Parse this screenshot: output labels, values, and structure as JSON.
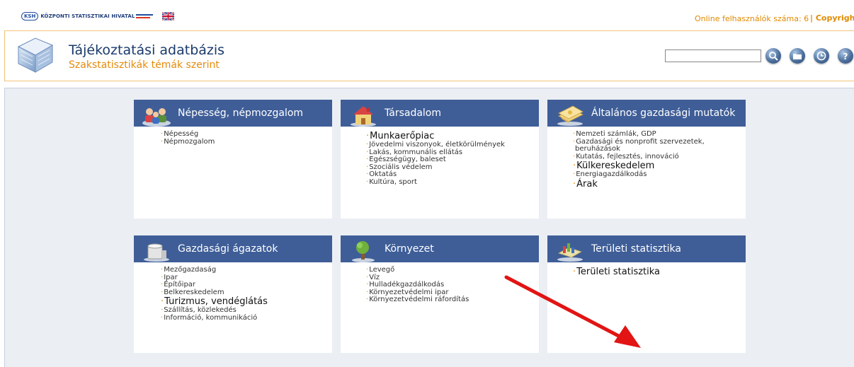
{
  "topbar": {
    "logo_abbr": "KSH",
    "logo_text": "KÖZPONTI STATISZTIKAI HIVATAL",
    "online_label": "Online felhasználók száma: 6",
    "copyright": "Copyright"
  },
  "header": {
    "title": "Tájékoztatási adatbázis",
    "subtitle": "Szakstatisztikák témák szerint",
    "search_value": ""
  },
  "icons": {
    "flag": "uk-flag-icon",
    "search": "search-icon",
    "folder": "folder-icon",
    "clock": "clock-icon",
    "help": "help-icon"
  },
  "panels": [
    {
      "title": "Népesség, népmozgalom",
      "items": [
        {
          "label": "Népesség"
        },
        {
          "label": "Népmozgalom"
        }
      ]
    },
    {
      "title": "Társadalom",
      "items": [
        {
          "label": "Munkaerőpiac",
          "big": true
        },
        {
          "label": "Jövedelmi viszonyok, életkörülmények"
        },
        {
          "label": "Lakás, kommunális ellátás"
        },
        {
          "label": "Egészségügy, baleset"
        },
        {
          "label": "Szociális védelem"
        },
        {
          "label": "Oktatás"
        },
        {
          "label": "Kultúra, sport"
        }
      ]
    },
    {
      "title": "Általános gazdasági mutatók",
      "items": [
        {
          "label": "Nemzeti számlák, GDP"
        },
        {
          "label": "Gazdasági és nonprofit szervezetek,"
        },
        {
          "label": "beruházások",
          "cont": true
        },
        {
          "label": "Kutatás, fejlesztés, innováció"
        },
        {
          "label": "Külkereskedelem",
          "big": true
        },
        {
          "label": "Energiagazdálkodás"
        },
        {
          "label": "Árak",
          "big": true
        }
      ]
    },
    {
      "title": "Gazdasági ágazatok",
      "items": [
        {
          "label": "Mezőgazdaság"
        },
        {
          "label": "Ipar"
        },
        {
          "label": "Építőipar"
        },
        {
          "label": "Belkereskedelem"
        },
        {
          "label": "Turizmus, vendéglátás",
          "big": true
        },
        {
          "label": "Szállítás, közlekedés"
        },
        {
          "label": "Információ, kommunikáció"
        }
      ]
    },
    {
      "title": "Környezet",
      "items": [
        {
          "label": "Levegő"
        },
        {
          "label": "Víz"
        },
        {
          "label": "Hulladékgazdálkodás"
        },
        {
          "label": "Környezetvédelmi ipar"
        },
        {
          "label": "Környezetvédelmi ráfordítás"
        }
      ]
    },
    {
      "title": "Területi statisztika",
      "items": [
        {
          "label": "Területi statisztika",
          "big": true
        }
      ]
    }
  ],
  "colors": {
    "panel_header": "#3f5e98",
    "accent_orange": "#e08a00",
    "arrow_red": "#e21414"
  }
}
